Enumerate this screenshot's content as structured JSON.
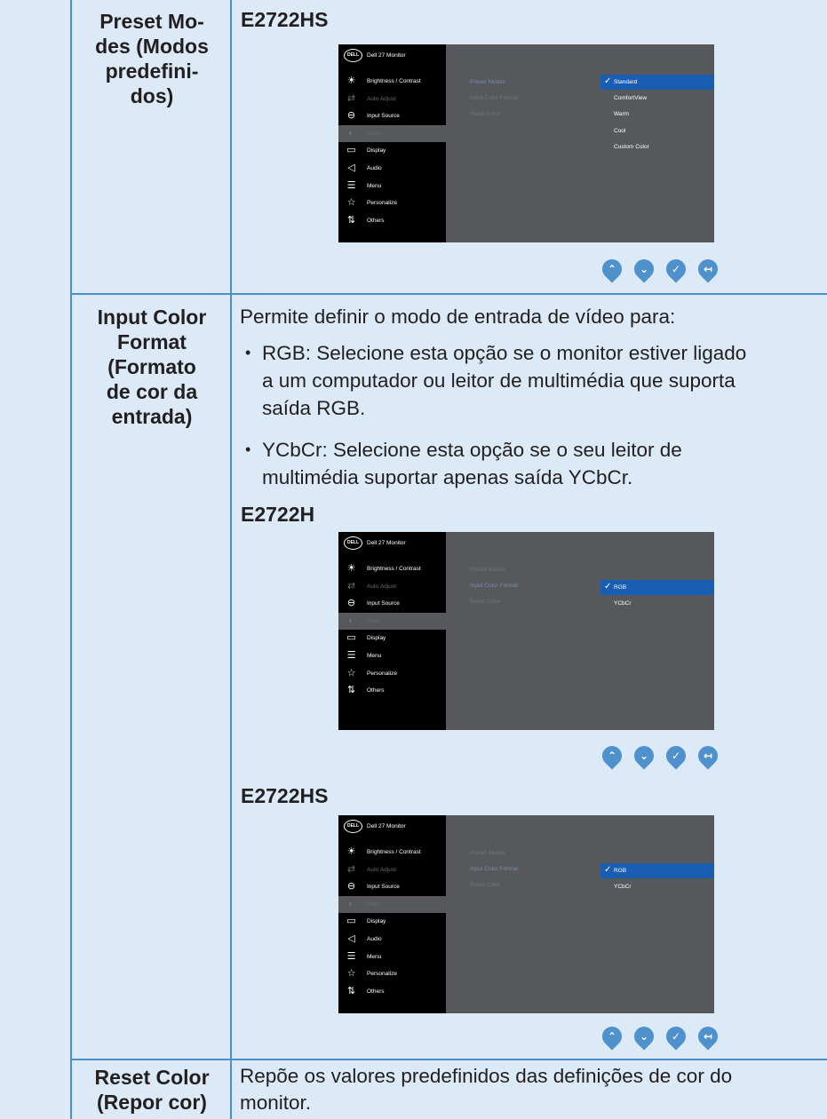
{
  "rows": {
    "preset": {
      "setting": "Preset Mo-\ndes (Modos\npredefini-\ndos)",
      "model": "E2722HS"
    },
    "input": {
      "setting": "Input Color\nFormat\n(Formato\nde cor da\nentrada)",
      "intro": "Permite definir o modo de entrada de vídeo para:",
      "bullets": [
        {
          "term": "RGB:",
          "text": " Selecione esta opção se o monitor estiver ligado\na um computador ou leitor de multimédia que suporta\nsaída RGB."
        },
        {
          "term": "YCbCr:",
          "text": " Selecione esta opção se o seu leitor de\nmultimédia suportar apenas saída YCbCr."
        }
      ],
      "model_a": "E2722H",
      "model_b": "E2722HS"
    },
    "reset": {
      "setting": "Reset Color\n(Repor cor)",
      "text": "Repõe os valores predefinidos das definições de cor do\nmonitor."
    }
  },
  "osd": {
    "logo": "DELL",
    "monitor_name": "Dell 27 Monitor",
    "menu_full": [
      "Brightness / Contrast",
      "Auto Adjust",
      "Input Source",
      "Color",
      "Display",
      "Audio",
      "Menu",
      "Personalize",
      "Others"
    ],
    "menu_noaudio": [
      "Brightness / Contrast",
      "Auto Adjust",
      "Input Source",
      "Color",
      "Display",
      "Menu",
      "Personalize",
      "Others"
    ],
    "submenu": [
      "Preset Modes",
      "Input Color Format",
      "Reset Color"
    ],
    "preset_options": [
      "Standard",
      "ComfortView",
      "Warm",
      "Cool",
      "Custom Color"
    ],
    "format_options": [
      "RGB",
      "YCbCr"
    ],
    "check": "✓"
  },
  "nav_glyphs": [
    "⌃",
    "⌄",
    "✓",
    "↤"
  ],
  "colors": {
    "accent": "#4e91cc",
    "border": "#4f8fc9",
    "background": "#dbeaf6",
    "osd_select": "#1a5eb4"
  }
}
